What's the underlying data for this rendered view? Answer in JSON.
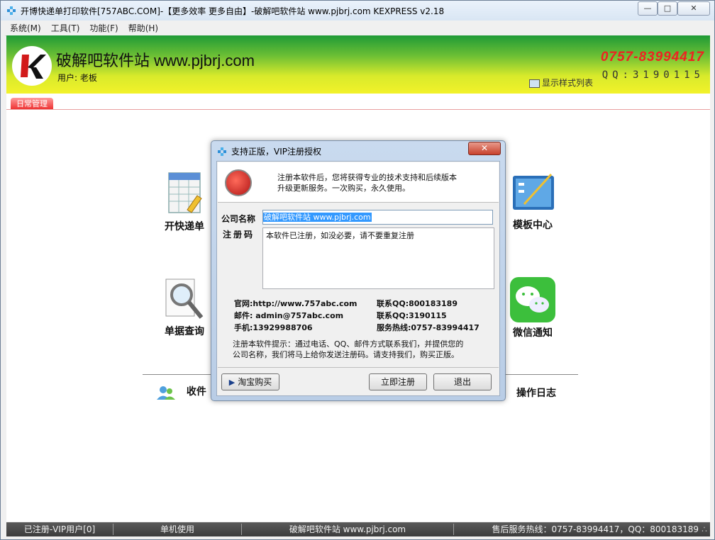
{
  "window": {
    "title": "开博快递单打印软件[757ABC.COM]-【更多效率 更多自由】-破解吧软件站 www.pjbrj.com  KEXPRESS v2.18",
    "min_label": "▭",
    "max_label": "▢",
    "close_label": "✕"
  },
  "menu": [
    "系统(M)",
    "工具(T)",
    "功能(F)",
    "帮助(H)"
  ],
  "banner": {
    "brand": "破解吧软件站 www.pjbrj.com",
    "user": "用户: 老板",
    "phone": "0757-83994417",
    "qq": "QQ:3190115",
    "styles_link": "显示样式列表"
  },
  "tab": "日常管理",
  "modules": {
    "waybill": "开快递单",
    "template": "模板中心",
    "query": "单据查询",
    "wechat": "微信通知",
    "recipient": "收件",
    "oplog": "操作日志"
  },
  "status": {
    "reg": "已注册-VIP用户[0]",
    "mode": "单机使用",
    "site": "破解吧软件站 www.pjbrj.com",
    "hotline": "售后服务热线：0757-83994417，QQ：800183189"
  },
  "dialog": {
    "title": "支持正版，VIP注册授权",
    "intro_line1": "注册本软件后，您将获得专业的技术支持和后续版本",
    "intro_line2": "升级更新服务。一次购买，永久使用。",
    "company_label": "公司名称",
    "company_value": "破解吧软件站 www.pjbrj.com",
    "reg_label": "注册码",
    "reg_value": "本软件已注册，如没必要，请不要重复注册",
    "website": "官网:http://www.757abc.com",
    "email": "邮件: admin@757abc.com",
    "mobile": "手机:13929988706",
    "qq1": "联系QQ:800183189",
    "qq2": "联系QQ:3190115",
    "hotline": "服务热线:0757-83994417",
    "hint_line1": "注册本软件提示：通过电话、QQ、邮件方式联系我们，并提供您的",
    "hint_line2": "公司名称，我们将马上给你发送注册码。请支持我们，购买正版。",
    "btn_taobao": "淘宝购买",
    "btn_register": "立即注册",
    "btn_exit": "退出"
  },
  "colors": {
    "phone": "#ee2222",
    "tab": "#ee3333",
    "banner_top": "#1f9a36",
    "banner_bottom": "#f2f22a"
  }
}
